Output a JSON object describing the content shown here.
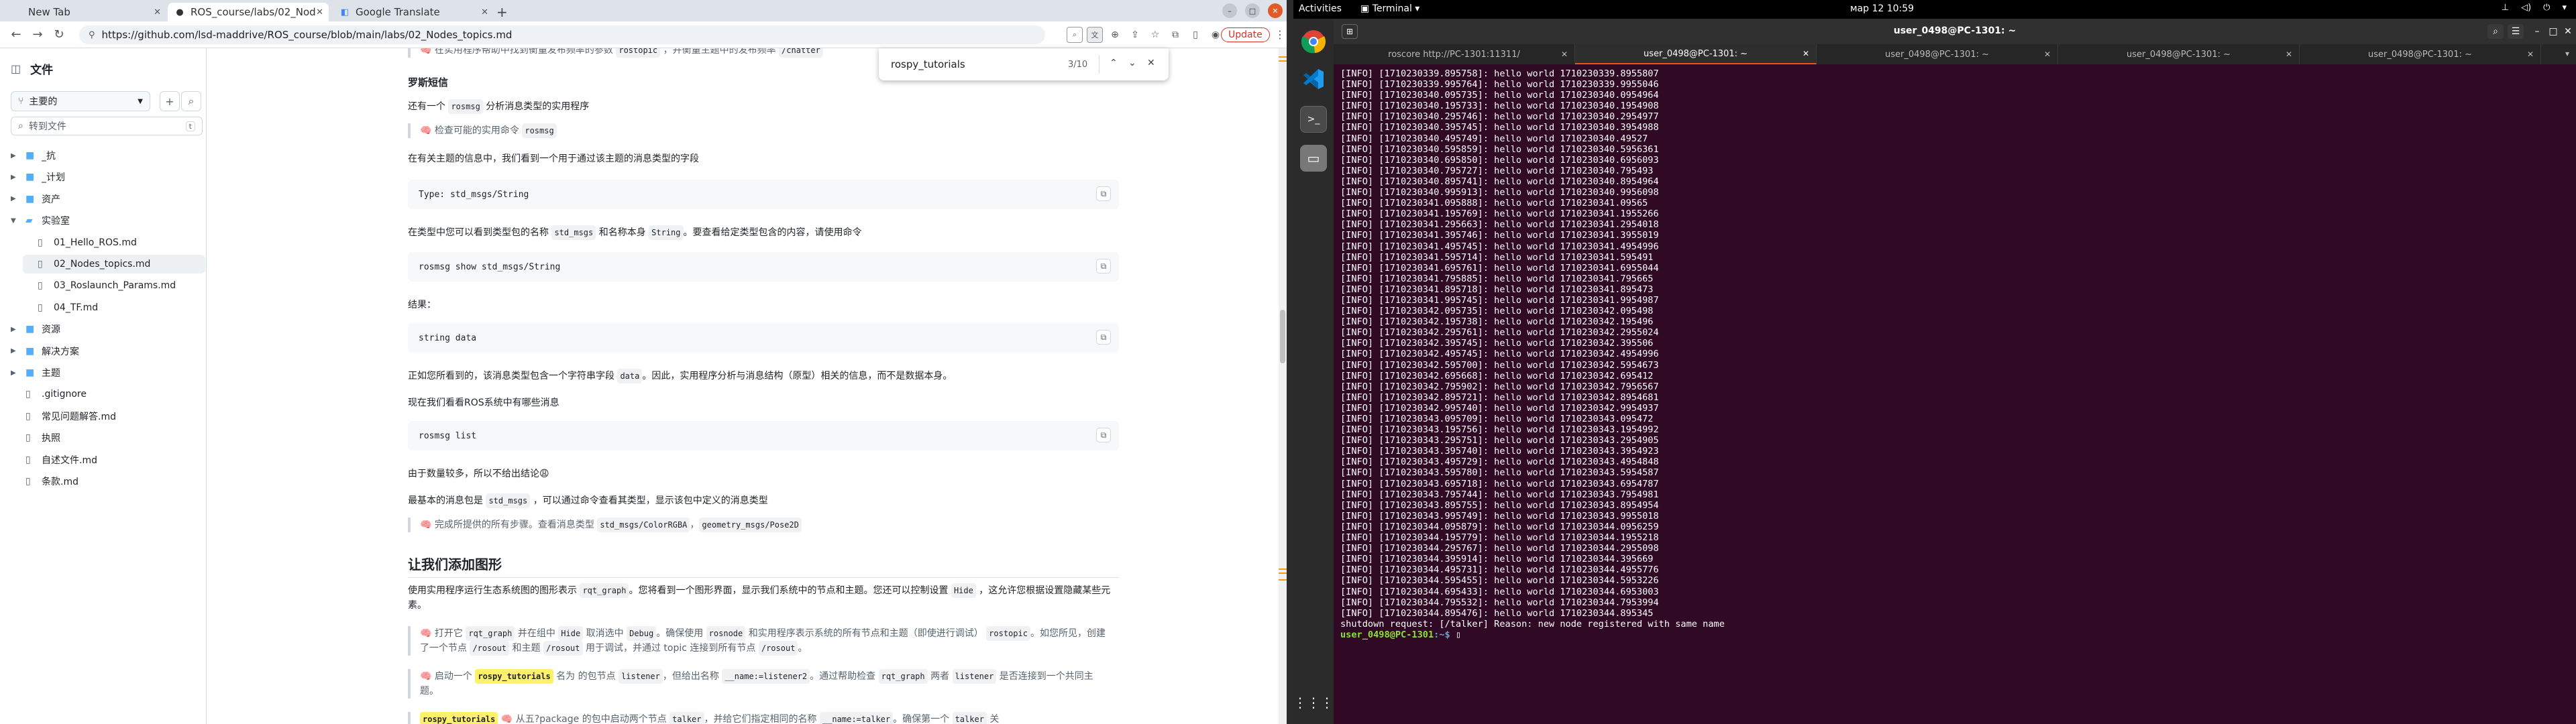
{
  "browser": {
    "tabs": [
      {
        "label": "New Tab",
        "icon": "new-tab-icon"
      },
      {
        "label": "ROS_course/labs/02_Nod",
        "icon": "github-icon"
      },
      {
        "label": "Google Translate",
        "icon": "translate-icon"
      }
    ],
    "url": "https://github.com/lsd-maddrive/ROS_course/blob/main/labs/02_Nodes_topics.md",
    "update_label": "Update",
    "find": {
      "query": "rospy_tutorials",
      "count": "3/10"
    }
  },
  "filetree": {
    "title": "文件",
    "branch": "主要的",
    "search_placeholder": "转到文件",
    "search_kbd": "t",
    "items": [
      {
        "label": "_抗",
        "type": "folder",
        "level": 0
      },
      {
        "label": "_计划",
        "type": "folder",
        "level": 0
      },
      {
        "label": "资产",
        "type": "folder",
        "level": 0
      },
      {
        "label": "实验室",
        "type": "folder-open",
        "level": 0
      },
      {
        "label": "01_Hello_ROS.md",
        "type": "file",
        "level": 1
      },
      {
        "label": "02_Nodes_topics.md",
        "type": "file",
        "level": 1
      },
      {
        "label": "03_Roslaunch_Params.md",
        "type": "file",
        "level": 1
      },
      {
        "label": "04_TF.md",
        "type": "file",
        "level": 1
      },
      {
        "label": "资源",
        "type": "folder",
        "level": 0
      },
      {
        "label": "解决方案",
        "type": "folder",
        "level": 0
      },
      {
        "label": "主题",
        "type": "folder",
        "level": 0
      },
      {
        "label": ".gitignore",
        "type": "file",
        "level": 0
      },
      {
        "label": "常见问题解答.md",
        "type": "file",
        "level": 0
      },
      {
        "label": "执照",
        "type": "file",
        "level": 0
      },
      {
        "label": "自述文件.md",
        "type": "file",
        "level": 0
      },
      {
        "label": "条款.md",
        "type": "file",
        "level": 0
      }
    ]
  },
  "article": {
    "top_note_a": "🧠 在实用程序帮助中找到衡量发布频率的参数",
    "top_note_code": "rostopic",
    "top_note_b": "，并衡量主题中的发布频率",
    "top_note_code2": "/chatter",
    "h_short": "罗斯短信",
    "p1_a": "还有一个",
    "p1_code": "rosmsg",
    "p1_b": "分析消息类型的实用程序",
    "q1_a": "🧠 检查可能的实用命令",
    "q1_code": "rosmsg",
    "p2": "在有关主题的信息中，我们看到一个用于通过该主题的消息类型的字段",
    "pre1": "Type: std_msgs/String",
    "p3_a": "在类型中您可以看到类型包的名称",
    "p3_code1": "std_msgs",
    "p3_b": "和名称本身",
    "p3_code2": "String",
    "p3_c": "。要查看给定类型包含的内容，请使用命令",
    "pre2": "rosmsg show std_msgs/String",
    "p4": "结果：",
    "pre3": "string data",
    "p5_a": "正如您所看到的，该消息类型包含一个字符串字段",
    "p5_code": "data",
    "p5_b": "。因此，实用程序分析与消息结构（原型）相关的信息，而不是数据本身。",
    "p6": "现在我们看看ROS系统中有哪些消息",
    "pre4": "rosmsg list",
    "p7": "由于数量较多，所以不给出结论😩",
    "p8_a": "最基本的消息包是",
    "p8_code": "std_msgs",
    "p8_b": "，可以通过命令查看其类型，显示该包中定义的消息类型",
    "q2_a": "🧠 完成所提供的所有步骤。查看消息类型",
    "q2_code1": "std_msgs/ColorRGBA",
    "q2_sep": "，",
    "q2_code2": "geometry_msgs/Pose2D",
    "h2": "让我们添加图形",
    "p9_a": "使用实用程序运行生态系统图的图形表示",
    "p9_code1": "rqt_graph",
    "p9_b": "。您将看到一个图形界面，显示我们系统中的节点和主题。您还可以控制设置",
    "p9_code2": "Hide",
    "p9_c": "，这允许您根据设置隐藏某些元素。",
    "q3_a": "🧠 打开它",
    "q3_code1": "rqt_graph",
    "q3_b": "并在组中",
    "q3_code2": "Hide",
    "q3_c": "取消选中",
    "q3_code3": "Debug",
    "q3_d": "。确保使用",
    "q3_code4": "rosnode",
    "q3_e": "和实用程序表示系统的所有节点和主题（即使进行调试）",
    "q3_code5": "rostopic",
    "q3_f": "。如您所见，创建了一个节点",
    "q3_code6": "/rosout",
    "q3_g": "和主题",
    "q3_code7": "/rosout",
    "q3_h": "用于调试，并通过 topic 连接到所有节点",
    "q3_code8": "/rosout",
    "q3_i": "。",
    "q4_a": "🧠 启动一个",
    "q4_hl": "rospy_tutorials",
    "q4_b": "名为 的包节点",
    "q4_code1": "listener",
    "q4_c": "，但给出名称",
    "q4_code2": "__name:=listener2",
    "q4_d": "。通过帮助检查",
    "q4_code3": "rqt_graph",
    "q4_e": "两者",
    "q4_code4": "listener",
    "q4_f": "是否连接到一个共同主题。",
    "q5_hl": "rospy_tutorials",
    "q5_a": "🧠 从五?package 的包中启动两个节点",
    "q5_code1": "talker",
    "q5_b": "，并给它们指定相同的名称",
    "q5_code2": "__name:=talker",
    "q5_c": "。确保第一个",
    "q5_code3": "talker",
    "q5_d": "关"
  },
  "desktop": {
    "activities": "Activities",
    "app": "Terminal",
    "clock": "мар 12  10:59",
    "term_title": "user_0498@PC-1301: ~",
    "term_tabs": [
      {
        "label": "roscore http://PC-1301:11311/"
      },
      {
        "label": "user_0498@PC-1301: ~",
        "active": true
      },
      {
        "label": "user_0498@PC-1301: ~"
      },
      {
        "label": "user_0498@PC-1301: ~"
      },
      {
        "label": "user_0498@PC-1301: ~"
      }
    ],
    "log_lines": [
      "[INFO] [1710230339.895758]: hello world 1710230339.8955807",
      "[INFO] [1710230339.995764]: hello world 1710230339.9955046",
      "[INFO] [1710230340.095735]: hello world 1710230340.0954964",
      "[INFO] [1710230340.195733]: hello world 1710230340.1954908",
      "[INFO] [1710230340.295746]: hello world 1710230340.2954977",
      "[INFO] [1710230340.395745]: hello world 1710230340.3954988",
      "[INFO] [1710230340.495749]: hello world 1710230340.49527",
      "[INFO] [1710230340.595859]: hello world 1710230340.5956361",
      "[INFO] [1710230340.695850]: hello world 1710230340.6956093",
      "[INFO] [1710230340.795727]: hello world 1710230340.795493",
      "[INFO] [1710230340.895741]: hello world 1710230340.8954964",
      "[INFO] [1710230340.995913]: hello world 1710230340.9956098",
      "[INFO] [1710230341.095888]: hello world 1710230341.09565",
      "[INFO] [1710230341.195769]: hello world 1710230341.1955266",
      "[INFO] [1710230341.295663]: hello world 1710230341.2954018",
      "[INFO] [1710230341.395746]: hello world 1710230341.3955019",
      "[INFO] [1710230341.495745]: hello world 1710230341.4954996",
      "[INFO] [1710230341.595714]: hello world 1710230341.595491",
      "[INFO] [1710230341.695761]: hello world 1710230341.6955044",
      "[INFO] [1710230341.795885]: hello world 1710230341.795665",
      "[INFO] [1710230341.895718]: hello world 1710230341.895473",
      "[INFO] [1710230341.995745]: hello world 1710230341.9954987",
      "[INFO] [1710230342.095735]: hello world 1710230342.095498",
      "[INFO] [1710230342.195738]: hello world 1710230342.195496",
      "[INFO] [1710230342.295761]: hello world 1710230342.2955024",
      "[INFO] [1710230342.395745]: hello world 1710230342.395506",
      "[INFO] [1710230342.495745]: hello world 1710230342.4954996",
      "[INFO] [1710230342.595700]: hello world 1710230342.5954673",
      "[INFO] [1710230342.695668]: hello world 1710230342.695412",
      "[INFO] [1710230342.795902]: hello world 1710230342.7956567",
      "[INFO] [1710230342.895721]: hello world 1710230342.8954681",
      "[INFO] [1710230342.995740]: hello world 1710230342.9954937",
      "[INFO] [1710230343.095709]: hello world 1710230343.095472",
      "[INFO] [1710230343.195756]: hello world 1710230343.1954992",
      "[INFO] [1710230343.295751]: hello world 1710230343.2954905",
      "[INFO] [1710230343.395740]: hello world 1710230343.3954923",
      "[INFO] [1710230343.495729]: hello world 1710230343.4954848",
      "[INFO] [1710230343.595780]: hello world 1710230343.5954587",
      "[INFO] [1710230343.695718]: hello world 1710230343.6954787",
      "[INFO] [1710230343.795744]: hello world 1710230343.7954981",
      "[INFO] [1710230343.895755]: hello world 1710230343.8954954",
      "[INFO] [1710230343.995749]: hello world 1710230343.9955018",
      "[INFO] [1710230344.095879]: hello world 1710230344.0956259",
      "[INFO] [1710230344.195779]: hello world 1710230344.1955218",
      "[INFO] [1710230344.295767]: hello world 1710230344.2955098",
      "[INFO] [1710230344.395914]: hello world 1710230344.395669",
      "[INFO] [1710230344.495731]: hello world 1710230344.4955776",
      "[INFO] [1710230344.595455]: hello world 1710230344.5953226",
      "[INFO] [1710230344.695433]: hello world 1710230344.6953003",
      "[INFO] [1710230344.795532]: hello world 1710230344.7953994",
      "[INFO] [1710230344.895476]: hello world 1710230344.895345"
    ],
    "shutdown_line": "shutdown request: [/talker] Reason: new node registered with same name",
    "prompt_user": "user_0498@PC-1301",
    "prompt_path": ":~$"
  }
}
